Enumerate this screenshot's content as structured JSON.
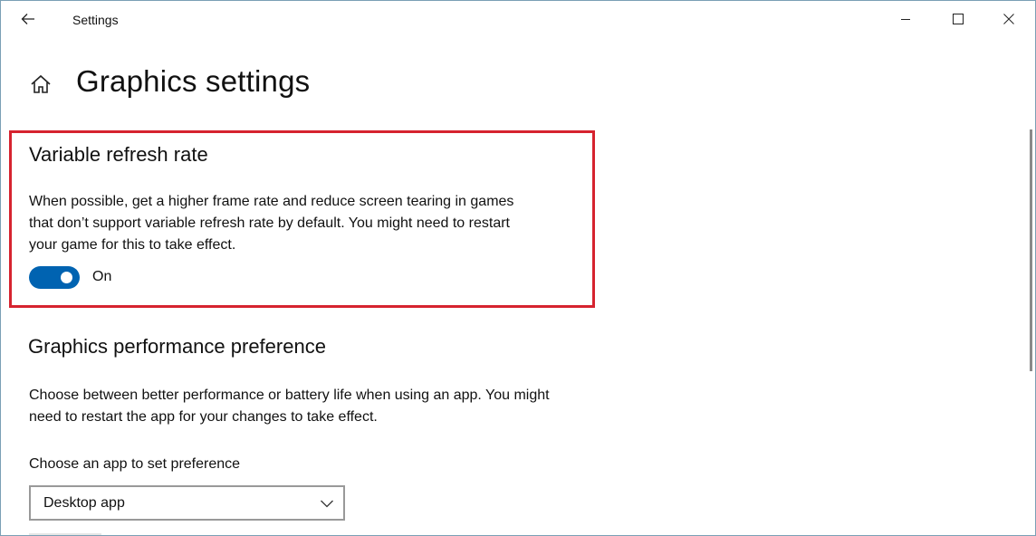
{
  "window": {
    "app_title": "Settings"
  },
  "header": {
    "page_title": "Graphics settings"
  },
  "variable_refresh_rate": {
    "title": "Variable refresh rate",
    "description": "When possible, get a higher frame rate and reduce screen tearing in games that don’t support variable refresh rate by default. You might need to restart your game for this to take effect.",
    "toggle_state": "On",
    "toggle_on": true
  },
  "graphics_performance": {
    "title": "Graphics performance preference",
    "description": "Choose between better performance or battery life when using an app. You might need to restart the app for your changes to take effect.",
    "choose_label": "Choose an app to set preference",
    "selected_app": "Desktop app"
  },
  "colors": {
    "accent": "#0063b1",
    "highlight_border": "#d6232f"
  },
  "icons": {
    "back": "back-arrow-icon",
    "home": "home-icon",
    "minimize": "minimize-icon",
    "maximize": "maximize-icon",
    "close": "close-icon",
    "dropdown": "chevron-down-icon"
  }
}
